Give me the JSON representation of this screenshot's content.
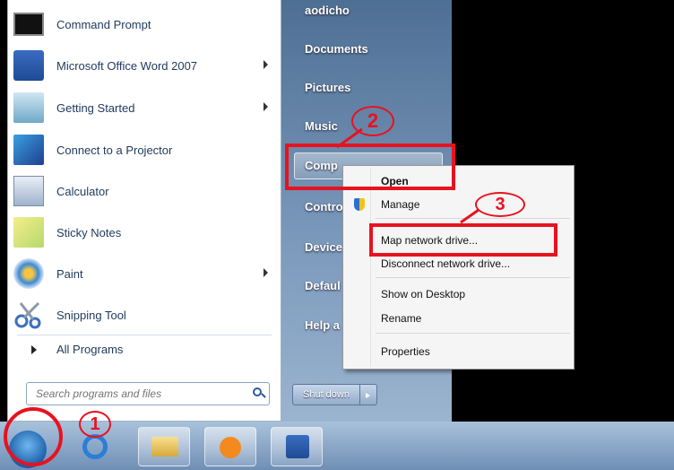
{
  "programs": [
    {
      "label": "Command Prompt",
      "icon": "command-prompt-icon",
      "submenu": false
    },
    {
      "label": "Microsoft Office Word 2007",
      "icon": "word-icon",
      "submenu": true
    },
    {
      "label": "Getting Started",
      "icon": "getting-started-icon",
      "submenu": true
    },
    {
      "label": "Connect to a Projector",
      "icon": "projector-icon",
      "submenu": false
    },
    {
      "label": "Calculator",
      "icon": "calculator-icon",
      "submenu": false
    },
    {
      "label": "Sticky Notes",
      "icon": "sticky-notes-icon",
      "submenu": false
    },
    {
      "label": "Paint",
      "icon": "paint-icon",
      "submenu": true
    },
    {
      "label": "Snipping Tool",
      "icon": "scissors-icon",
      "submenu": false
    }
  ],
  "all_programs": "All Programs",
  "search": {
    "placeholder": "Search programs and files"
  },
  "right_pane": {
    "user": "aodicho",
    "documents": "Documents",
    "pictures": "Pictures",
    "music": "Music",
    "computer": "Comp",
    "control": "Contro",
    "devices": "Device",
    "default": "Defaul",
    "help": "Help a",
    "shutdown": "Shut down"
  },
  "context_menu": {
    "open": "Open",
    "manage": "Manage",
    "map_drive": "Map network drive...",
    "disconnect": "Disconnect network drive...",
    "show_desktop": "Show on Desktop",
    "rename": "Rename",
    "properties": "Properties"
  },
  "annotations": {
    "step1": "1",
    "step2": "2",
    "step3": "3"
  },
  "colors": {
    "annotation": "#e8121f",
    "pane_text": "#1e395b"
  }
}
